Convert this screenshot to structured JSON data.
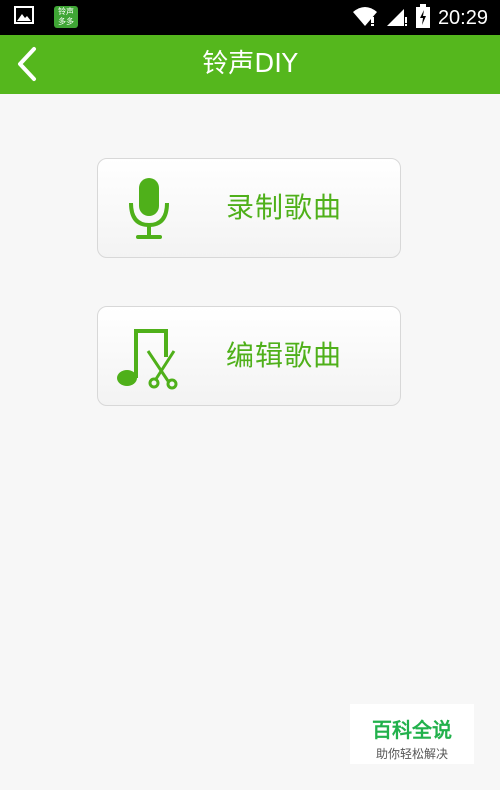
{
  "status_bar": {
    "time": "20:29",
    "app_badge_line1": "铃声",
    "app_badge_line2": "多多",
    "icons": [
      "image-icon",
      "app-badge-icon",
      "wifi-icon",
      "signal-icon",
      "battery-charging-icon"
    ]
  },
  "header": {
    "title": "铃声DIY",
    "back_icon": "chevron-left-icon"
  },
  "menu": {
    "items": [
      {
        "label": "录制歌曲",
        "icon": "microphone-icon"
      },
      {
        "label": "编辑歌曲",
        "icon": "music-scissors-icon"
      }
    ]
  },
  "watermark": {
    "main": "百科全说",
    "sub": "助你轻松解决"
  },
  "colors": {
    "accent": "#55b71d",
    "label_green": "#4fb01a",
    "background": "#f7f7f7"
  }
}
